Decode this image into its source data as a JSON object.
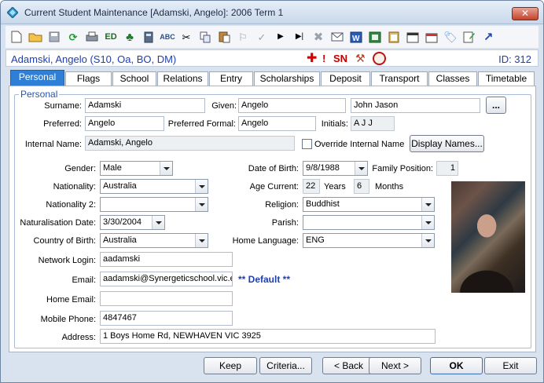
{
  "window": {
    "title": "Current Student Maintenance  [Adamski, Angelo]:  2006 Term 1",
    "close_label": "✕"
  },
  "toolbar": {
    "icons": [
      "new-icon",
      "open-icon",
      "save-icon",
      "refresh-icon",
      "print-icon",
      "ed-icon",
      "tree-icon",
      "calculator-icon",
      "spellcheck-icon",
      "cut-icon",
      "copy-icon",
      "paste-icon",
      "flag-outline-icon",
      "check-icon",
      "next-arrow-icon",
      "last-arrow-icon",
      "delete-icon",
      "mail-icon",
      "word-icon",
      "excel-icon",
      "clipboard-icon",
      "calendar-icon",
      "timetable-icon",
      "tag-icon",
      "note-edit-icon",
      "jump-arrow-icon"
    ],
    "ed_label": "ED"
  },
  "student": {
    "display": "Adamski, Angelo (S10, Oa, BO, DM)",
    "id_label": "ID: 312",
    "flags": [
      "red-cross-icon",
      "alert-icon",
      "SN",
      "hammer-icon",
      "tortoise-icon"
    ],
    "sn_label": "SN",
    "alert_label": "!"
  },
  "tabs": [
    "Personal",
    "Flags",
    "School",
    "Relations",
    "Entry",
    "Scholarships",
    "Deposit",
    "Transport",
    "Classes",
    "Timetable"
  ],
  "group": {
    "legend": "Personal"
  },
  "form": {
    "surname_label": "Surname:",
    "surname": "Adamski",
    "given_label": "Given:",
    "given": "Angelo",
    "middle": "John Jason",
    "ellipsis_label": "...",
    "preferred_label": "Preferred:",
    "preferred": "Angelo",
    "preferred_formal_label": "Preferred Formal:",
    "preferred_formal": "Angelo",
    "initials_label": "Initials:",
    "initials": "A J J",
    "internal_name_label": "Internal Name:",
    "internal_name": "Adamski, Angelo",
    "override_label": "Override Internal Name",
    "display_names_label": "Display Names...",
    "gender_label": "Gender:",
    "gender": "Male",
    "nationality_label": "Nationality:",
    "nationality": "Australia",
    "nationality2_label": "Nationality 2:",
    "nationality2": "",
    "naturalisation_label": "Naturalisation Date:",
    "naturalisation": "3/30/2004",
    "country_birth_label": "Country of Birth:",
    "country_birth": "Australia",
    "network_login_label": "Network Login:",
    "network_login": "aadamski",
    "email_label": "Email:",
    "email": "aadamski@Synergeticschool.vic.edu.au",
    "default_label": "** Default **",
    "home_email_label": "Home Email:",
    "home_email": "",
    "mobile_label": "Mobile Phone:",
    "mobile": "4847467",
    "address_label": "Address:",
    "address": "1 Boys Home Rd, NEWHAVEN VIC 3925",
    "dob_label": "Date of Birth:",
    "dob": "9/8/1988",
    "family_position_label": "Family Position:",
    "family_position": "1",
    "age_label": "Age Current:",
    "age_years": "22",
    "years_label": "Years",
    "age_months": "6",
    "months_label": "Months",
    "religion_label": "Religion:",
    "religion": "Buddhist",
    "parish_label": "Parish:",
    "parish": "",
    "home_language_label": "Home Language:",
    "home_language": "ENG"
  },
  "buttons": {
    "keep": "Keep",
    "criteria": "Criteria...",
    "back": "< Back",
    "next": "Next >",
    "ok": "OK",
    "exit": "Exit"
  },
  "colors": {
    "accent": "#2f7fd7",
    "student_text": "#1e3fb0"
  }
}
